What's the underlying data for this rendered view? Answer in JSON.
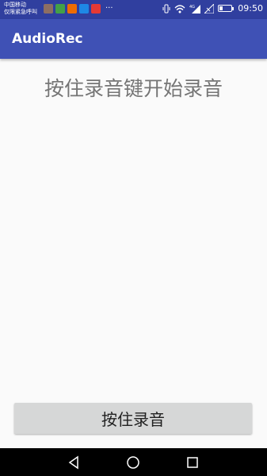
{
  "status_bar": {
    "carrier_line1": "中国移动",
    "carrier_line2": "仅限紧急呼叫",
    "notification_icons": [
      "app-icon",
      "wechat-icon",
      "weibo-icon",
      "gallery-icon",
      "location-icon"
    ],
    "more_indicator": "···",
    "network_label": "4G",
    "battery_level": 0.3,
    "time": "09:50"
  },
  "action_bar": {
    "title": "AudioRec"
  },
  "main": {
    "hint_text": "按住录音键开始录音",
    "record_button_label": "按住录音"
  },
  "colors": {
    "status_bar": "#303f9f",
    "action_bar": "#3f51b5",
    "background": "#fafafa",
    "button": "#d6d7d7"
  },
  "nav_bar": {
    "icons": [
      "back-icon",
      "home-icon",
      "recents-icon"
    ]
  }
}
